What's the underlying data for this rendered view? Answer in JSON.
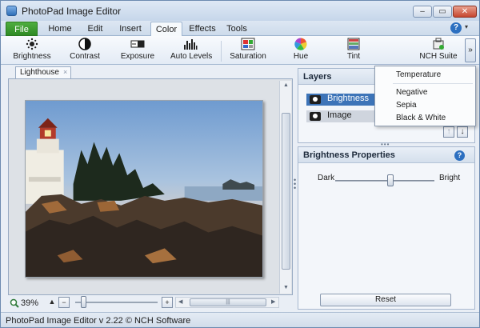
{
  "window": {
    "title": "PhotoPad Image Editor",
    "controls": {
      "minimize": "–",
      "maximize": "▭",
      "close": "✕"
    }
  },
  "menu": {
    "tabs": [
      "File",
      "Home",
      "Edit",
      "Insert",
      "Color",
      "Effects",
      "Tools"
    ],
    "active": "Color",
    "help_glyph": "?",
    "help_arrow": "▾"
  },
  "ribbon": {
    "buttons": [
      {
        "label": "Brightness",
        "icon": "brightness-icon"
      },
      {
        "label": "Contrast",
        "icon": "contrast-icon"
      },
      {
        "label": "Exposure",
        "icon": "exposure-icon"
      },
      {
        "label": "Auto Levels",
        "icon": "auto-levels-icon"
      },
      {
        "label": "Saturation",
        "icon": "saturation-icon"
      },
      {
        "label": "Hue",
        "icon": "hue-icon"
      },
      {
        "label": "Tint",
        "icon": "tint-icon"
      },
      {
        "label": "NCH Suite",
        "icon": "nch-suite-icon"
      }
    ],
    "more": "»"
  },
  "document": {
    "tab_label": "Lighthouse",
    "tab_close": "×"
  },
  "layers": {
    "title": "Layers",
    "items": [
      {
        "label": "Brightness",
        "selected": true
      },
      {
        "label": "Image",
        "selected": false
      }
    ],
    "up": "↑",
    "down": "↓"
  },
  "dropdown": {
    "items": [
      "Temperature",
      "Negative",
      "Sepia",
      "Black & White"
    ]
  },
  "properties": {
    "title": "Brightness Properties",
    "help_glyph": "?",
    "slider": {
      "left_label": "Dark",
      "right_label": "Bright",
      "value_fraction": 0.56
    },
    "reset_label": "Reset"
  },
  "canvas": {
    "zoom": "39%",
    "zoom_in": "+",
    "zoom_out": "−",
    "up_arrow": "▲",
    "zoom_slider_fraction": 0.1,
    "hscroll_grip": "|||",
    "hscroll_left": "◀",
    "hscroll_right": "▶",
    "vscroll_up": "▲",
    "vscroll_down": "▼"
  },
  "status": {
    "text": "PhotoPad Image Editor v 2.22 © NCH Software"
  },
  "colors": {
    "accent": "#3d74b8",
    "file_tab": "#2f8a24",
    "help": "#2c6fc0"
  }
}
